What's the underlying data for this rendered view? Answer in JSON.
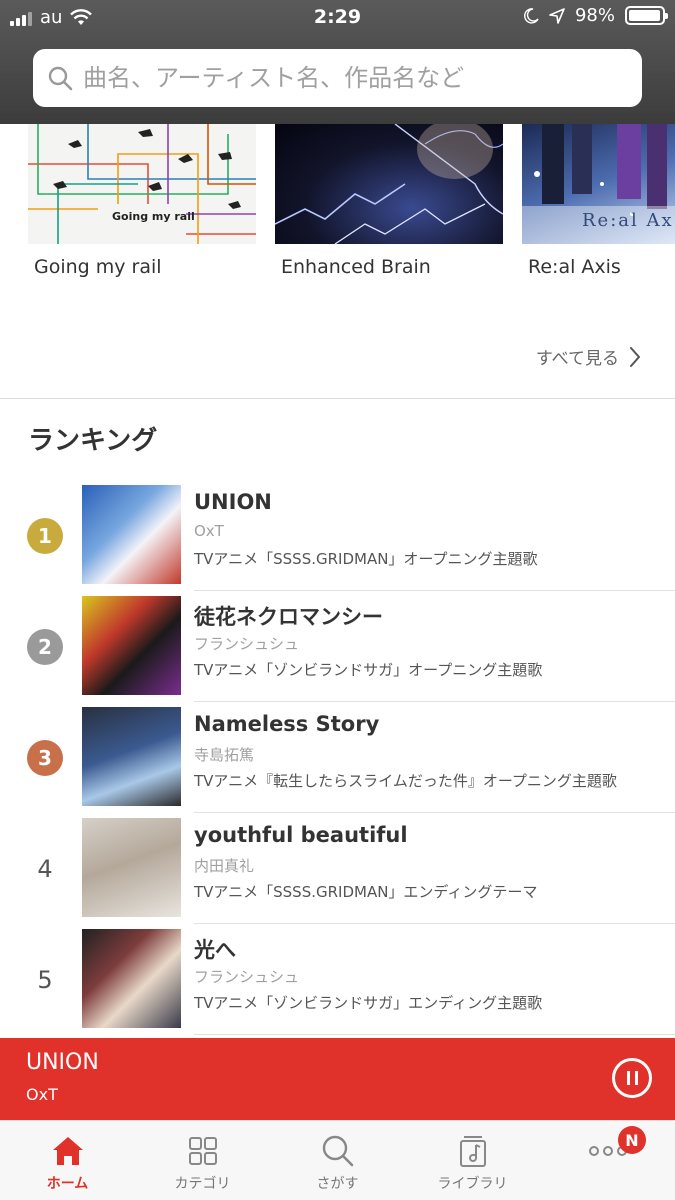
{
  "status_bar": {
    "carrier": "au",
    "time": "2:29",
    "battery": "98%",
    "battery_level": 0.98
  },
  "search": {
    "placeholder": "曲名、アーティスト名、作品名など"
  },
  "albums": [
    {
      "title": "Going my rail",
      "cover_text": "Going my rail"
    },
    {
      "title": "Enhanced Brain"
    },
    {
      "title": "Re:al Axis",
      "cover_text": "Re:al Ax"
    }
  ],
  "see_all": "すべて見る",
  "ranking": {
    "title": "ランキング",
    "items": [
      {
        "rank": "1",
        "title": "UNION",
        "artist": "OxT",
        "desc": "TVアニメ「SSSS.GRIDMAN」オープニング主題歌",
        "badge_color": "#c9aa3c"
      },
      {
        "rank": "2",
        "title": "徒花ネクロマンシー",
        "artist": "フランシュシュ",
        "desc": "TVアニメ「ゾンビランドサガ」オープニング主題歌",
        "badge_color": "#9a9a9a"
      },
      {
        "rank": "3",
        "title": "Nameless Story",
        "artist": "寺島拓篤",
        "desc": "TVアニメ『転生したらスライムだった件』オープニング主題歌",
        "badge_color": "#c8704a"
      },
      {
        "rank": "4",
        "title": "youthful beautiful",
        "artist": "内田真礼",
        "desc": "TVアニメ「SSSS.GRIDMAN」エンディングテーマ"
      },
      {
        "rank": "5",
        "title": "光へ",
        "artist": "フランシュシュ",
        "desc": "TVアニメ「ゾンビランドサガ」エンディング主題歌"
      }
    ]
  },
  "player": {
    "title": "UNION",
    "artist": "OxT"
  },
  "tabs": [
    {
      "label": "ホーム",
      "icon": "home-icon"
    },
    {
      "label": "カテゴリ",
      "icon": "grid-icon"
    },
    {
      "label": "さがす",
      "icon": "search-icon"
    },
    {
      "label": "ライブラリ",
      "icon": "music-note-icon"
    },
    {
      "label": "",
      "icon": "more-icon",
      "badge": "N"
    }
  ],
  "colors": {
    "accent": "#e0312a",
    "header": "#4a4a4a"
  }
}
